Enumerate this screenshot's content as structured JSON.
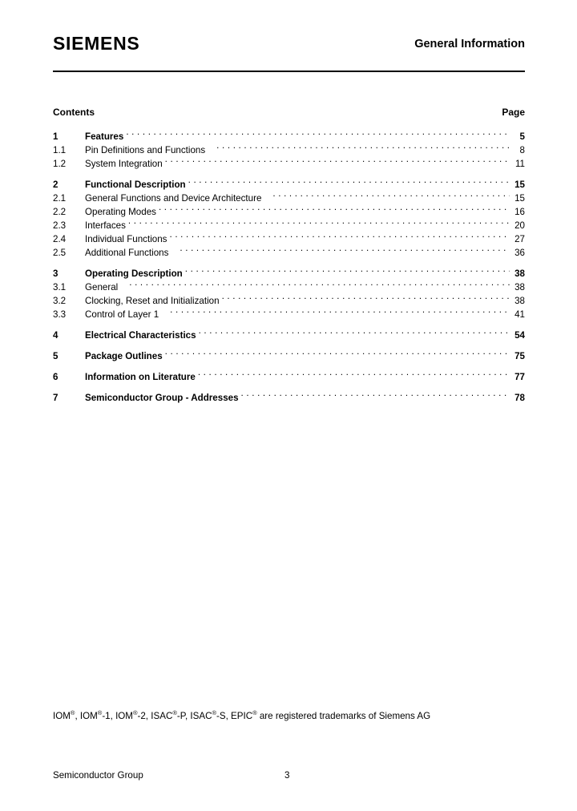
{
  "header": {
    "brand": "SIEMENS",
    "title": "General Information"
  },
  "toc": {
    "contents_label": "Contents",
    "page_label": "Page",
    "groups": [
      {
        "rows": [
          {
            "number": "1",
            "title": "Features",
            "page": "5",
            "level": 1,
            "gap": false
          },
          {
            "number": "1.1",
            "title": "Pin Definitions and Functions",
            "page": "8",
            "level": 2,
            "gap": true
          },
          {
            "number": "1.2",
            "title": "System Integration",
            "page": "11",
            "level": 2,
            "gap": false
          }
        ]
      },
      {
        "rows": [
          {
            "number": "2",
            "title": "Functional Description",
            "page": "15",
            "level": 1,
            "gap": false
          },
          {
            "number": "2.1",
            "title": "General Functions and Device Architecture",
            "page": "15",
            "level": 2,
            "gap": true
          },
          {
            "number": "2.2",
            "title": "Operating Modes",
            "page": "16",
            "level": 2,
            "gap": false
          },
          {
            "number": "2.3",
            "title": "Interfaces",
            "page": "20",
            "level": 2,
            "gap": false
          },
          {
            "number": "2.4",
            "title": "Individual Functions",
            "page": "27",
            "level": 2,
            "gap": false
          },
          {
            "number": "2.5",
            "title": "Additional Functions",
            "page": "36",
            "level": 2,
            "gap": true
          }
        ]
      },
      {
        "rows": [
          {
            "number": "3",
            "title": "Operating Description",
            "page": "38",
            "level": 1,
            "gap": false
          },
          {
            "number": "3.1",
            "title": "General",
            "page": "38",
            "level": 2,
            "gap": true
          },
          {
            "number": "3.2",
            "title": "Clocking, Reset and Initialization",
            "page": "38",
            "level": 2,
            "gap": false
          },
          {
            "number": "3.3",
            "title": "Control of Layer 1",
            "page": "41",
            "level": 2,
            "gap": true
          }
        ]
      },
      {
        "rows": [
          {
            "number": "4",
            "title": "Electrical Characteristics",
            "page": "54",
            "level": 1,
            "gap": false
          }
        ]
      },
      {
        "rows": [
          {
            "number": "5",
            "title": "Package Outlines",
            "page": "75",
            "level": 1,
            "gap": false
          }
        ]
      },
      {
        "rows": [
          {
            "number": "6",
            "title": "Information on Literature",
            "page": "77",
            "level": 1,
            "gap": false
          }
        ]
      },
      {
        "rows": [
          {
            "number": "7",
            "title": "Semiconductor Group - Addresses",
            "page": "78",
            "level": 1,
            "gap": false
          }
        ]
      }
    ]
  },
  "trademark": {
    "parts": [
      {
        "text": "IOM"
      },
      {
        "sup": "®"
      },
      {
        "text": ", IOM"
      },
      {
        "sup": "®"
      },
      {
        "text": "-1, IOM"
      },
      {
        "sup": "®"
      },
      {
        "text": "-2, ISAC"
      },
      {
        "sup": "®"
      },
      {
        "text": "-P, ISAC"
      },
      {
        "sup": "®"
      },
      {
        "text": "-S, EPIC"
      },
      {
        "sup": "®"
      },
      {
        "text": " are registered trademarks of Siemens AG"
      }
    ]
  },
  "footer": {
    "left": "Semiconductor Group",
    "page_number": "3"
  }
}
